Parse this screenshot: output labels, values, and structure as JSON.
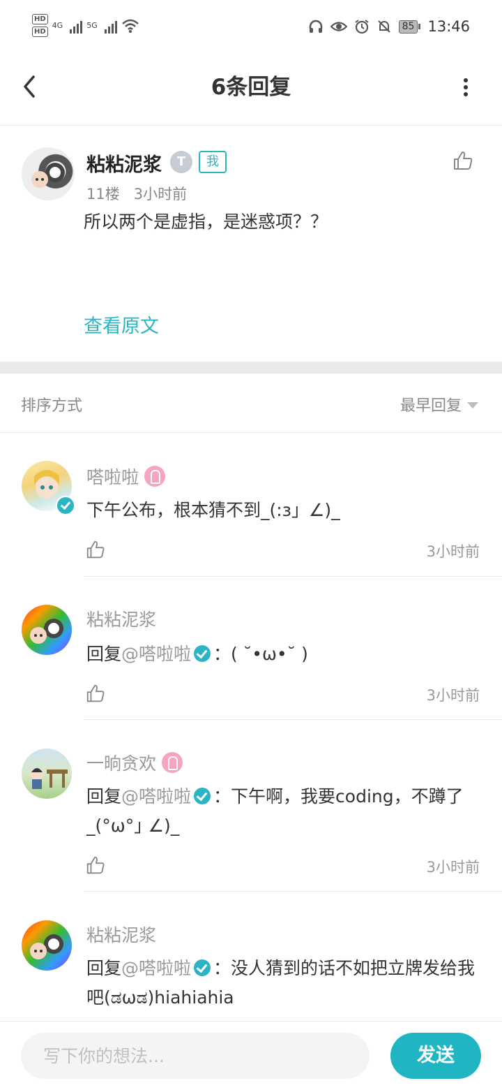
{
  "status_bar": {
    "left": {
      "hd1": "HD",
      "hd2": "HD",
      "net1": "4G",
      "net2": "5G"
    },
    "battery": "85",
    "time": "13:46"
  },
  "header": {
    "title": "6条回复"
  },
  "main_post": {
    "author": "粘粘泥浆",
    "level_badge": "T",
    "me_badge": "我",
    "floor": "11楼",
    "time": "3小时前",
    "text": "所以两个是虚指，是迷惑项？？",
    "view_original": "查看原文"
  },
  "sort": {
    "label": "排序方式",
    "selected": "最早回复"
  },
  "replies": [
    {
      "author": "嗒啦啦",
      "text": "下午公布，根本猜不到_(:з」∠)_",
      "time": "3小时前"
    },
    {
      "author": "粘粘泥浆",
      "prefix": "回复",
      "mention": "@嗒啦啦",
      "text": "：( ˘•ω•˘ )",
      "time": "3小时前"
    },
    {
      "author": "一晌贪欢",
      "prefix": "回复",
      "mention": "@嗒啦啦",
      "text": "：下午啊，我要coding，不蹲了_(°ω°｣ ∠)_",
      "time": "3小时前"
    },
    {
      "author": "粘粘泥浆",
      "prefix": "回复",
      "mention": "@嗒啦啦",
      "text": "：没人猜到的话不如把立牌发给我吧(ಡωಡ)hiahiahia"
    }
  ],
  "composer": {
    "placeholder": "写下你的想法...",
    "send_label": "发送"
  },
  "colors": {
    "accent": "#1fb5c2",
    "vip_pink": "#f7a4be"
  }
}
